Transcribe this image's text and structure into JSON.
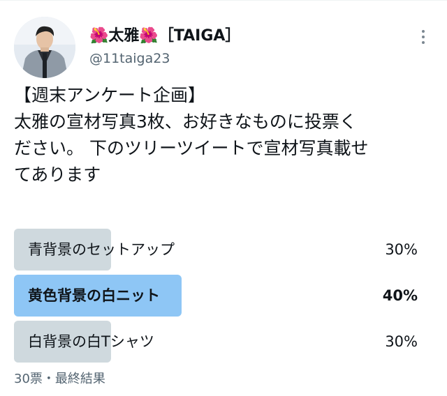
{
  "author": {
    "flower_left": "🌺",
    "name": "太雅",
    "flower_right": "🌺",
    "group_tag": "［TAIGA］",
    "handle": "@11taiga23",
    "avatar_icon": "profile-photo"
  },
  "menu": {
    "icon": "more-vertical-icon"
  },
  "tweet": {
    "lines": [
      "【週末アンケート企画】",
      "太雅の宣材写真3枚、お好きなものに投票く",
      "ださい。 下のツリーツイートで宣材写真載せ",
      "てあります"
    ]
  },
  "poll": {
    "options": [
      {
        "label": "青背景のセットアップ",
        "percent_text": "30%",
        "share": 0.3,
        "winner": false
      },
      {
        "label": "黄色背景の白ニット",
        "percent_text": "40%",
        "share": 0.4,
        "winner": true
      },
      {
        "label": "白背景の白Tシャツ",
        "percent_text": "30%",
        "share": 0.3,
        "winner": false
      }
    ],
    "footer": "30票・最終結果"
  },
  "colors": {
    "bar_default": "#cfd9de",
    "bar_winner": "#8ec6f5",
    "text_secondary": "#536471"
  }
}
